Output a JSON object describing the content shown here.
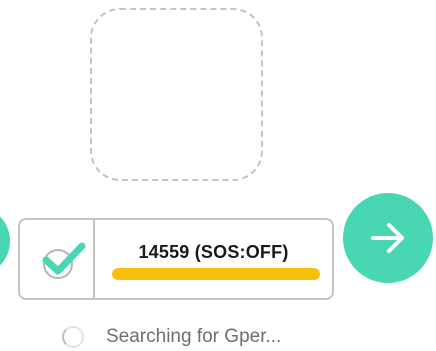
{
  "photo": {
    "icon": "dashed-rounded-placeholder"
  },
  "status_card": {
    "check_icon": "checkmark-circle-icon",
    "label": "14559 (SOS:OFF)",
    "progress": 1.0,
    "progress_color": "#f7c10a"
  },
  "next_button": {
    "icon": "arrow-right-icon",
    "color": "#48d6b3"
  },
  "left_button": {
    "color": "#48d6b3"
  },
  "search": {
    "icon": "spinner-icon",
    "text": "Searching for Gper..."
  }
}
